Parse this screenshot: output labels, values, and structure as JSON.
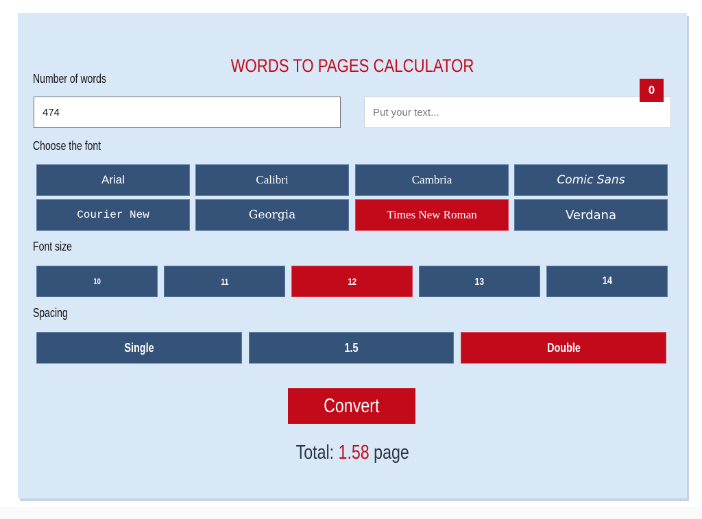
{
  "title": "WORDS TO PAGES CALCULATOR",
  "words": {
    "label": "Number of words",
    "value": "474"
  },
  "text_input": {
    "placeholder": "Put your text...",
    "word_count": "0"
  },
  "font": {
    "label": "Choose the font",
    "options": [
      "Arial",
      "Calibri",
      "Cambria",
      "Comic Sans",
      "Courier New",
      "Georgia",
      "Times New Roman",
      "Verdana"
    ],
    "selected": "Times New Roman"
  },
  "font_size": {
    "label": "Font size",
    "options": [
      "10",
      "11",
      "12",
      "13",
      "14"
    ],
    "selected": "12"
  },
  "spacing": {
    "label": "Spacing",
    "options": [
      "Single",
      "1.5",
      "Double"
    ],
    "selected": "Double"
  },
  "convert_label": "Convert",
  "result": {
    "prefix": "Total:",
    "value": "1.58",
    "unit": "page"
  },
  "colors": {
    "accent": "#c20a1a",
    "button": "#355278",
    "panel": "#d9e8f7"
  }
}
